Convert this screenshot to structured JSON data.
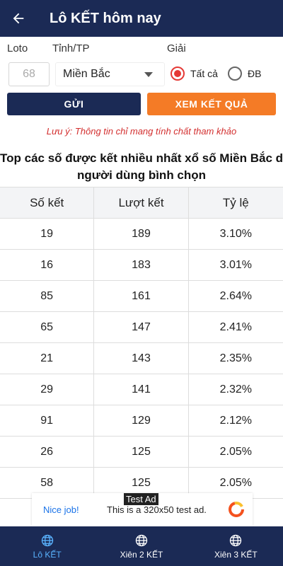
{
  "header": {
    "title": "Lô KẾT hôm nay",
    "back_icon": "arrow-left-icon"
  },
  "form": {
    "loto_label": "Loto",
    "province_label": "Tỉnh/TP",
    "prize_label": "Giải",
    "loto_placeholder": "68",
    "province_value": "Miền Bắc",
    "radio_all": "Tất cả",
    "radio_db": "ĐB",
    "selected": "all",
    "send_button": "GỬI",
    "view_button": "XEM KẾT QUẢ"
  },
  "note": "Lưu ý: Thông tin chỉ mang tính chất tham khảo",
  "heading": {
    "line1": "Top các số được kết nhiều nhất xổ số Miền Bắc do",
    "line2": "người dùng bình chọn"
  },
  "table": {
    "headers": [
      "Số kết",
      "Lượt kết",
      "Tỷ lệ"
    ],
    "rows": [
      [
        "19",
        "189",
        "3.10%"
      ],
      [
        "16",
        "183",
        "3.01%"
      ],
      [
        "85",
        "161",
        "2.64%"
      ],
      [
        "65",
        "147",
        "2.41%"
      ],
      [
        "21",
        "143",
        "2.35%"
      ],
      [
        "29",
        "141",
        "2.32%"
      ],
      [
        "91",
        "129",
        "2.12%"
      ],
      [
        "26",
        "125",
        "2.05%"
      ],
      [
        "58",
        "125",
        "2.05%"
      ]
    ]
  },
  "ad": {
    "tag": "Test Ad",
    "nice": "Nice job!",
    "text": "This is a 320x50 test ad."
  },
  "nav": {
    "items": [
      {
        "label": "Lô KẾT",
        "icon": "globe-icon",
        "active": true
      },
      {
        "label": "Xiên 2 KẾT",
        "icon": "globe-icon",
        "active": false
      },
      {
        "label": "Xiên 3 KẾT",
        "icon": "globe-icon",
        "active": false
      }
    ]
  },
  "colors": {
    "primary": "#1b2a55",
    "accent": "#f47b26",
    "note": "#d32f2f",
    "nav_active": "#5ab3ff"
  }
}
